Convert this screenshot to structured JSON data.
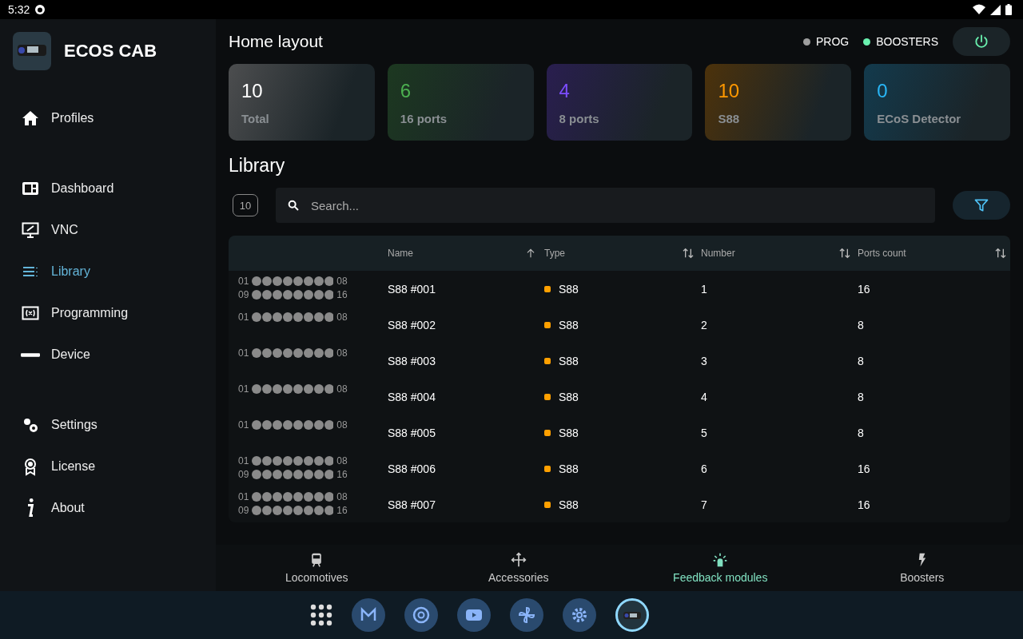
{
  "status_bar": {
    "time": "5:32"
  },
  "app": {
    "title": "ECOS CAB"
  },
  "sidebar": {
    "groups": [
      [
        {
          "label": "Profiles",
          "selected": false
        }
      ],
      [
        {
          "label": "Dashboard",
          "selected": false
        },
        {
          "label": "VNC",
          "selected": false
        },
        {
          "label": "Library",
          "selected": true
        },
        {
          "label": "Programming",
          "selected": false
        },
        {
          "label": "Device",
          "selected": false
        }
      ],
      [
        {
          "label": "Settings",
          "selected": false
        },
        {
          "label": "License",
          "selected": false
        },
        {
          "label": "About",
          "selected": false
        }
      ]
    ]
  },
  "header": {
    "title": "Home layout",
    "indicators": [
      {
        "label": "PROG",
        "color": "#9e9e9e"
      },
      {
        "label": "BOOSTERS",
        "color": "#69f0ae"
      }
    ]
  },
  "stats": [
    {
      "value": "10",
      "label": "Total",
      "color": "#ffffff"
    },
    {
      "value": "6",
      "label": "16 ports",
      "color": "#4caf50"
    },
    {
      "value": "4",
      "label": "8 ports",
      "color": "#7c4dff"
    },
    {
      "value": "10",
      "label": "S88",
      "color": "#ff9800"
    },
    {
      "value": "0",
      "label": "ECoS Detector",
      "color": "#29b6f6"
    }
  ],
  "library": {
    "title": "Library",
    "count": "10",
    "search": {
      "placeholder": "Search..."
    }
  },
  "table": {
    "columns": [
      {
        "label": "Name"
      },
      {
        "label": "Type"
      },
      {
        "label": "Number"
      },
      {
        "label": "Ports count"
      }
    ],
    "rows": [
      {
        "banks": [
          {
            "start": "01",
            "end": "08"
          },
          {
            "start": "09",
            "end": "16"
          }
        ],
        "name": "S88 #001",
        "type": "S88",
        "number": "1",
        "ports": "16"
      },
      {
        "banks": [
          {
            "start": "01",
            "end": "08"
          }
        ],
        "name": "S88 #002",
        "type": "S88",
        "number": "2",
        "ports": "8"
      },
      {
        "banks": [
          {
            "start": "01",
            "end": "08"
          }
        ],
        "name": "S88 #003",
        "type": "S88",
        "number": "3",
        "ports": "8"
      },
      {
        "banks": [
          {
            "start": "01",
            "end": "08"
          }
        ],
        "name": "S88 #004",
        "type": "S88",
        "number": "4",
        "ports": "8"
      },
      {
        "banks": [
          {
            "start": "01",
            "end": "08"
          }
        ],
        "name": "S88 #005",
        "type": "S88",
        "number": "5",
        "ports": "8"
      },
      {
        "banks": [
          {
            "start": "01",
            "end": "08"
          },
          {
            "start": "09",
            "end": "16"
          }
        ],
        "name": "S88 #006",
        "type": "S88",
        "number": "6",
        "ports": "16"
      },
      {
        "banks": [
          {
            "start": "01",
            "end": "08"
          },
          {
            "start": "09",
            "end": "16"
          }
        ],
        "name": "S88 #007",
        "type": "S88",
        "number": "7",
        "ports": "16"
      }
    ]
  },
  "bottom_nav": [
    {
      "label": "Locomotives",
      "selected": false
    },
    {
      "label": "Accessories",
      "selected": false
    },
    {
      "label": "Feedback modules",
      "selected": true
    },
    {
      "label": "Boosters",
      "selected": false
    }
  ],
  "taskbar": [
    {
      "selected": false
    },
    {
      "selected": false
    },
    {
      "selected": false
    },
    {
      "selected": false
    },
    {
      "selected": false
    },
    {
      "selected": true
    }
  ]
}
